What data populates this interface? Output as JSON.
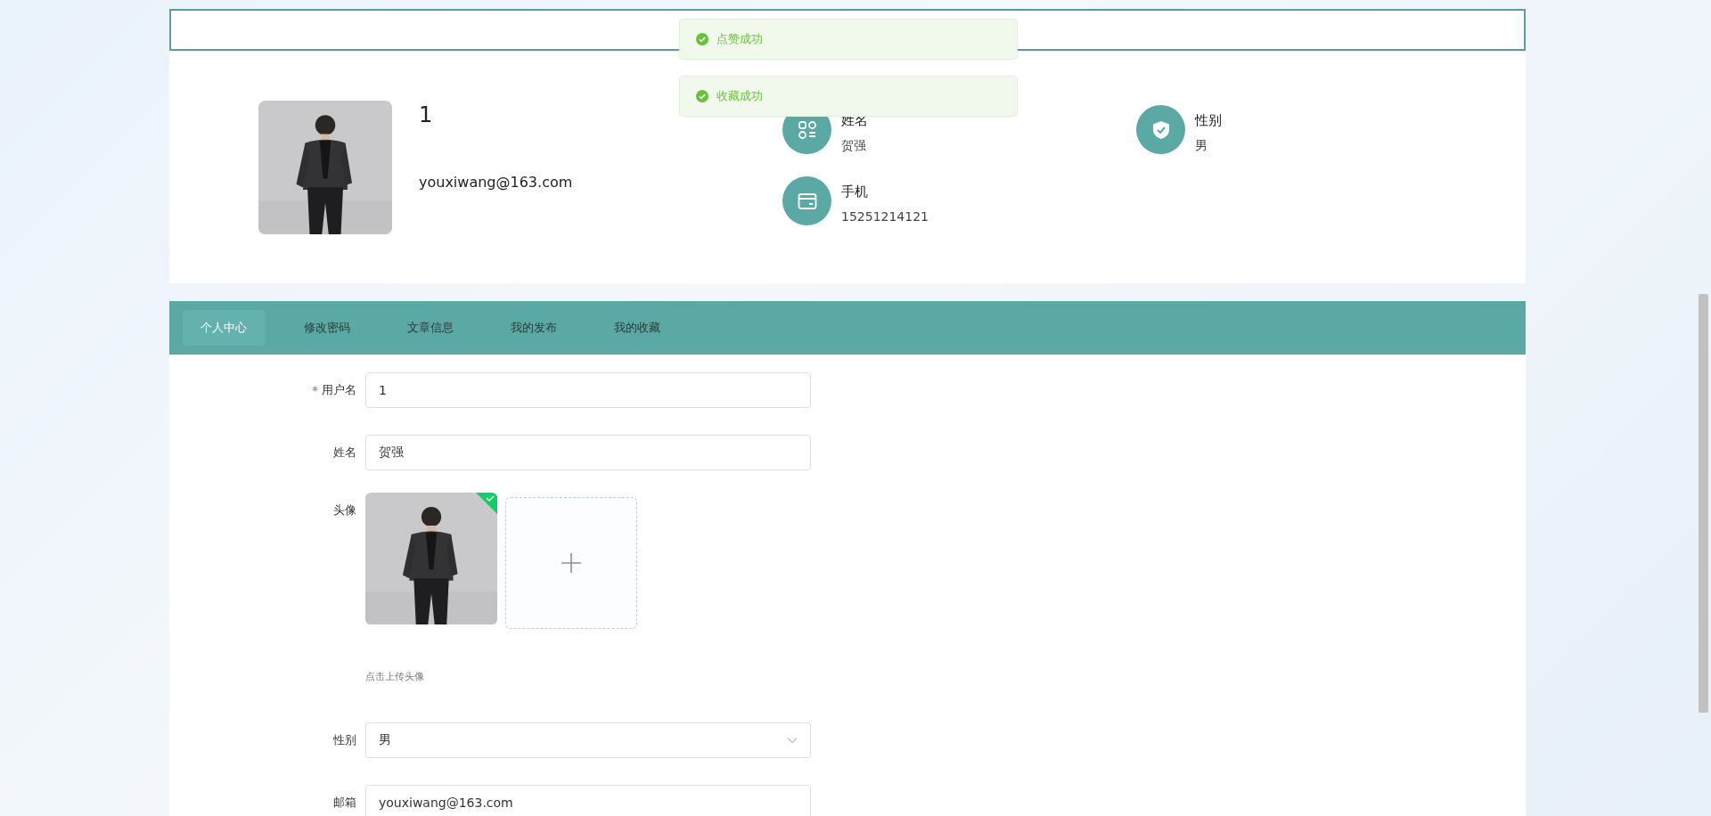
{
  "toasts": [
    {
      "kind": "success",
      "text": "点赞成功"
    },
    {
      "kind": "success",
      "text": "收藏成功"
    }
  ],
  "profile": {
    "username": "1",
    "email": "youxiwang@163.com",
    "info": [
      {
        "kind": "grid",
        "label": "姓名",
        "value": "贺强"
      },
      {
        "kind": "shield",
        "label": "性别",
        "value": "男"
      },
      {
        "kind": "card",
        "label": "手机",
        "value": "15251214121"
      }
    ]
  },
  "tabs": [
    {
      "label": "个人中心",
      "selected": true
    },
    {
      "label": "修改密码",
      "selected": false
    },
    {
      "label": "文章信息",
      "selected": false
    },
    {
      "label": "我的发布",
      "selected": false
    },
    {
      "label": "我的收藏",
      "selected": false
    }
  ],
  "form": {
    "fields": [
      {
        "kind": "text",
        "label": "用户名",
        "required": true,
        "value": "1"
      },
      {
        "kind": "text",
        "label": "姓名",
        "required": false,
        "value": "贺强"
      },
      {
        "kind": "upload",
        "label": "头像",
        "required": false,
        "uploaded": true,
        "hint": "点击上传头像"
      },
      {
        "kind": "select",
        "label": "性别",
        "required": false,
        "value": "男"
      },
      {
        "kind": "text",
        "label": "邮箱",
        "required": false,
        "value": "youxiwang@163.com"
      }
    ]
  }
}
